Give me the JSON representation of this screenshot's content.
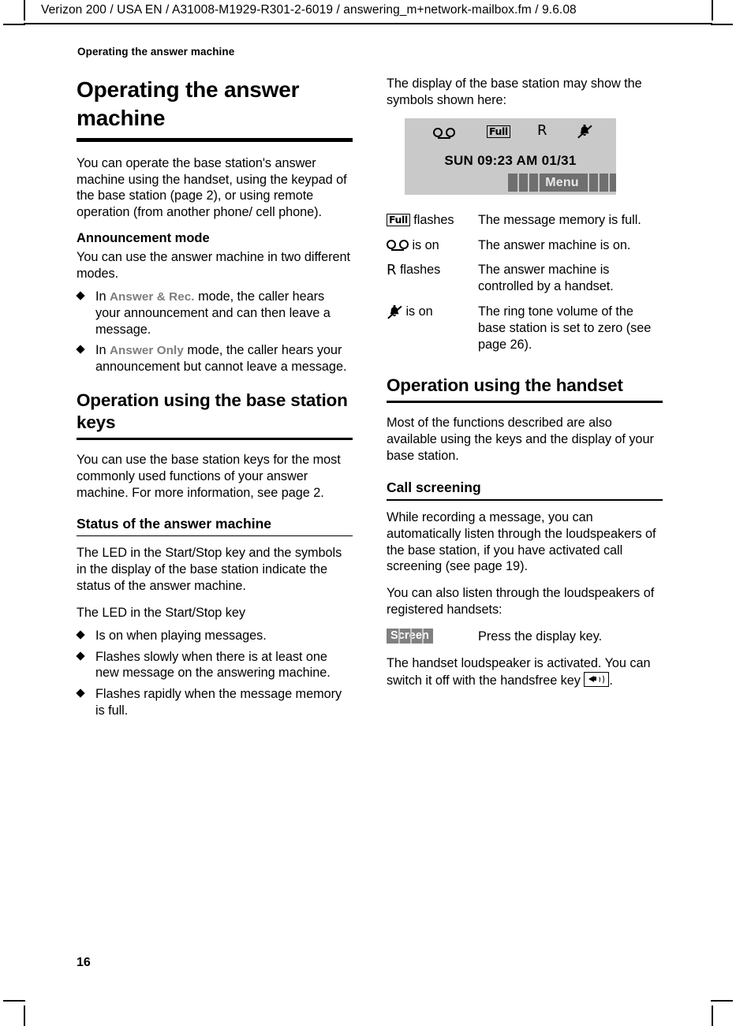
{
  "document": {
    "file_header": "Verizon 200 / USA EN / A31008-M1929-R301-2-6019 / answering_m+network-mailbox.fm / 9.6.08",
    "running_head": "Operating the answer machine",
    "page_number": "16"
  },
  "left_column": {
    "chapter_title": "Operating the answer machine",
    "intro_paragraph": "You can operate the base station's answer machine using the handset, using the keypad of the base station (page 2), or using remote operation (from another phone/ cell phone).",
    "announcement": {
      "heading": "Announcement mode",
      "paragraph": "You can use the answer machine in two different modes.",
      "bullets": [
        {
          "pre": "In ",
          "term": "Answer & Rec.",
          "post": " mode, the caller hears your announcement and can then leave a message."
        },
        {
          "pre": "In ",
          "term": "Answer Only",
          "post": " mode, the caller hears your announcement but cannot leave a message."
        }
      ]
    },
    "base_keys": {
      "heading": "Operation using the base station keys",
      "paragraph": "You can use the base station keys for the most commonly used functions of your answer machine. For more information, see page 2."
    },
    "status": {
      "heading": "Status of the answer machine",
      "paragraph1": "The LED in the Start/Stop key and the symbols in the display of the base station indicate the status of the answer machine.",
      "paragraph2": "The LED in the Start/Stop key",
      "bullets": [
        "Is on when playing messages.",
        "Flashes slowly when there is at least one new message on the answering machine.",
        "Flashes rapidly when the message memory is full."
      ]
    }
  },
  "right_column": {
    "display_intro": "The display of the base station may show the symbols shown here:",
    "display_panel": {
      "icons": [
        "answer-machine-reel-icon",
        "full-memory-icon",
        "remote-control-r-icon",
        "ringer-off-icon"
      ],
      "full_label": "Full",
      "r_label": "R",
      "time_line": "SUN 09:23 AM  01/31",
      "soft_key_label": "Menu",
      "background_color": "#c9c9c9",
      "soft_key_color": "#6f6f6f"
    },
    "symbol_table": [
      {
        "icon": "full-memory-icon",
        "symbol_text": "flashes",
        "description": "The message memory is full."
      },
      {
        "icon": "answer-machine-reel-icon",
        "symbol_text": "is on",
        "description": "The answer machine is on."
      },
      {
        "icon": "remote-control-r-icon",
        "symbol_text": "flashes",
        "description": "The answer machine is controlled by a handset."
      },
      {
        "icon": "ringer-off-icon",
        "symbol_text": "is on",
        "description": "The ring tone volume of the base station is set to zero (see page 26)."
      }
    ],
    "handset": {
      "heading": "Operation using the handset",
      "paragraph": "Most of the functions described are also available using the keys and the display of your base station."
    },
    "call_screening": {
      "heading": "Call screening",
      "paragraph1": "While recording a message, you can automatically listen through the loudspeakers of the base station, if you have activated call screening (see page 19).",
      "paragraph2": "You can also listen through the loudspeakers of registered handsets:",
      "screen_key_label": "Screen",
      "screen_key_action": "Press the display key.",
      "paragraph3_pre": "The handset loudspeaker is activated. You can switch it off with the handsfree key",
      "paragraph3_post": "."
    }
  }
}
